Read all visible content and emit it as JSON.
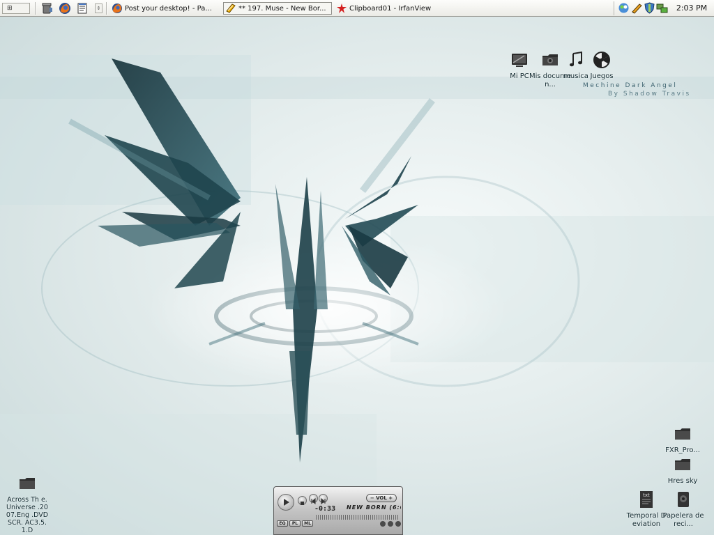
{
  "taskbar": {
    "start_label": "⊞",
    "quick_launch": [
      {
        "icon": "recycle-bin-icon"
      },
      {
        "icon": "firefox-icon"
      },
      {
        "icon": "notepad-icon"
      }
    ],
    "quick_launch_arrow": "⇕",
    "tasks": [
      {
        "label": "Post your desktop! - Pa...",
        "icon": "firefox-icon",
        "active": false
      },
      {
        "label": "** 197. Muse - New Bor...",
        "icon": "winamp-icon",
        "active": true
      },
      {
        "label": "Clipboard01 - IrfanView",
        "icon": "irfanview-icon",
        "active": false
      }
    ],
    "tray_icons": [
      "messenger-icon",
      "pencil-icon",
      "shield-icon",
      "network-icon"
    ],
    "clock": "2:03 PM"
  },
  "theme": {
    "title": "Mechine Dark Angel",
    "subtitle": "By Shadow Travis"
  },
  "desktop_icons": {
    "top_row": [
      {
        "label": "Mi PC",
        "icon": "my-computer-icon"
      },
      {
        "label": "Mis documen...",
        "icon": "my-documents-icon"
      },
      {
        "label": "musica",
        "icon": "music-icon"
      },
      {
        "label": "Juegos",
        "icon": "games-icon"
      }
    ],
    "right_column": [
      {
        "label": "FXR_Pro...",
        "icon": "folder-icon"
      },
      {
        "label": "Hres sky",
        "icon": "folder-icon"
      }
    ],
    "bottom_right": [
      {
        "label": "Temporal Deviation",
        "icon": "text-file-icon"
      },
      {
        "label": "Papelera de reci...",
        "icon": "recycle-bin-icon"
      }
    ],
    "bottom_left": [
      {
        "label": "Across Th e.Universe .2007.Eng .DVDSCR. AC3.5.1.D",
        "icon": "folder-icon"
      }
    ]
  },
  "player": {
    "time": "-0:33",
    "track": "NEW BORN (6:0",
    "volume_label": "VOL",
    "buttons": [
      "EQ",
      "PL",
      "ML"
    ]
  }
}
